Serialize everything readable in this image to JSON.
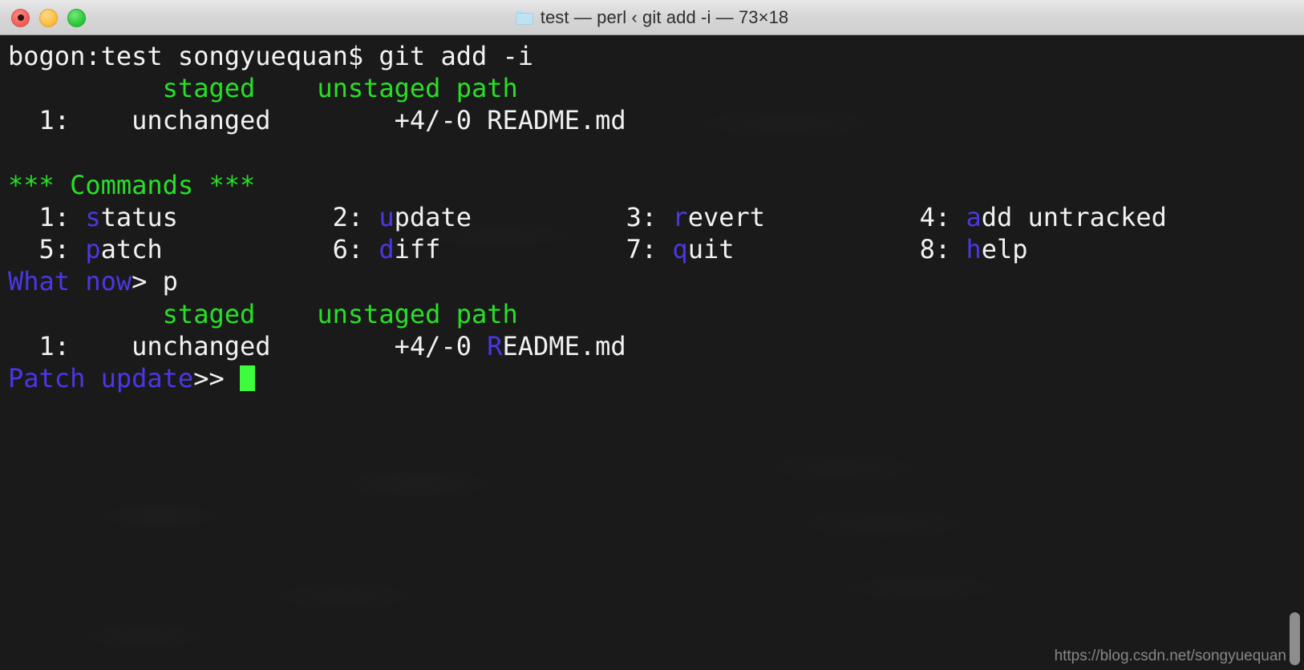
{
  "window": {
    "title": "test — perl ‹ git add -i — 73×18",
    "folder_icon": "folder-icon",
    "controls": {
      "close": "close-button",
      "minimize": "minimize-button",
      "maximize": "maximize-button"
    }
  },
  "terminal": {
    "columns": 73,
    "rows": 18,
    "background_color": "#1a1a1a",
    "foreground_color": "#f2f2f2",
    "green_color": "#27e027",
    "blue_color": "#4a37e6",
    "cursor_color": "#3cfc3c",
    "lines": {
      "prompt_command": {
        "prompt": "bogon:test songyuequan$ ",
        "command": "git add -i"
      },
      "status_header": {
        "indent": "          ",
        "staged": "staged",
        "gap": "    ",
        "unstaged_path": "unstaged path"
      },
      "status_row_1": {
        "index": "  1:",
        "staged_state": "    unchanged",
        "gap": "        ",
        "diffstat": "+4/-0",
        "space": " ",
        "path_first": "R",
        "path_rest": "EADME.md"
      },
      "commands_title": "*** Commands ***",
      "commands_row_1": [
        {
          "num": "  1: ",
          "key": "s",
          "rest": "tatus",
          "pad": "          "
        },
        {
          "num": "2: ",
          "key": "u",
          "rest": "pdate",
          "pad": "          "
        },
        {
          "num": "3: ",
          "key": "r",
          "rest": "evert",
          "pad": "          "
        },
        {
          "num": "4: ",
          "key": "a",
          "rest": "dd untracked",
          "pad": ""
        }
      ],
      "commands_row_2": [
        {
          "num": "  5: ",
          "key": "p",
          "rest": "atch",
          "pad": "           "
        },
        {
          "num": "6: ",
          "key": "d",
          "rest": "iff",
          "pad": "            "
        },
        {
          "num": "7: ",
          "key": "q",
          "rest": "uit",
          "pad": "            "
        },
        {
          "num": "8: ",
          "key": "h",
          "rest": "elp",
          "pad": ""
        }
      ],
      "what_now": {
        "label": "What now",
        "arrow": ">",
        "input": " p"
      },
      "patch_prompt": {
        "label": "Patch update",
        "arrow": ">>",
        "space": " "
      }
    }
  },
  "scrollbar": {
    "name": "vertical-scrollbar",
    "thumb": "scrollbar-thumb"
  },
  "watermark": {
    "text": "https://blog.csdn.net/songyuequan"
  }
}
